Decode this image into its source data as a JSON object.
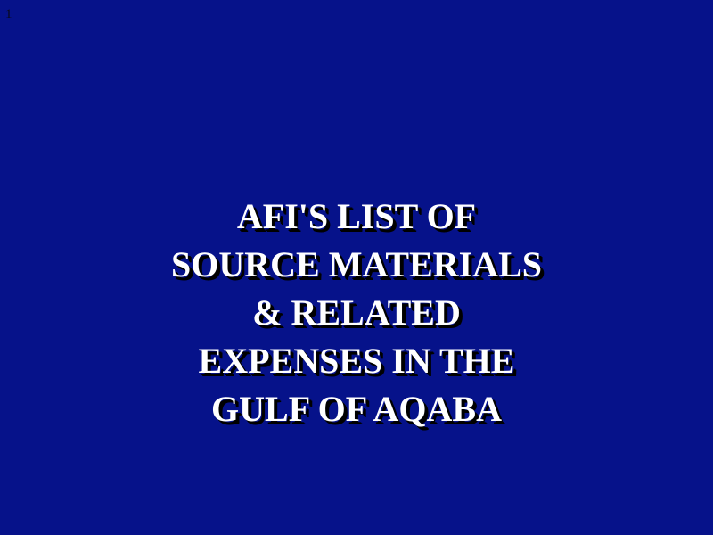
{
  "slide": {
    "number": "1",
    "clue_lines": [
      "AFI'S LIST OF",
      "SOURCE MATERIALS",
      "& RELATED",
      "EXPENSES IN THE",
      "GULF OF AQABA"
    ]
  },
  "colors": {
    "background": "#06128a",
    "text": "#ffffff",
    "shadow": "#000000"
  }
}
